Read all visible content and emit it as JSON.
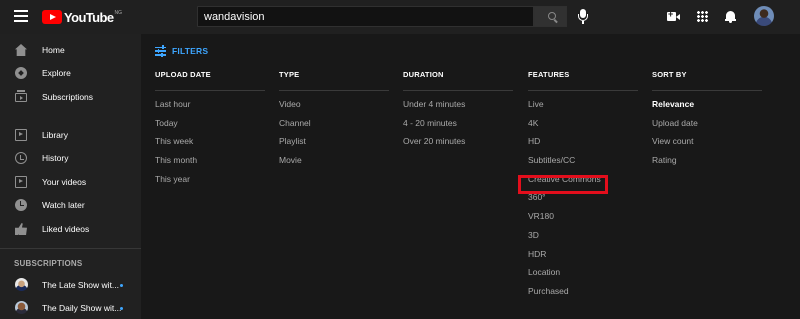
{
  "masthead": {
    "logo_text": "YouTube",
    "logo_country": "NG",
    "search_value": "wandavision"
  },
  "sidebar": {
    "items": [
      {
        "label": "Home",
        "icon": "home-icon"
      },
      {
        "label": "Explore",
        "icon": "explore-icon"
      },
      {
        "label": "Subscriptions",
        "icon": "subscriptions-icon"
      },
      {
        "label": "Library",
        "icon": "library-icon"
      },
      {
        "label": "History",
        "icon": "history-icon"
      },
      {
        "label": "Your videos",
        "icon": "your-videos-icon"
      },
      {
        "label": "Watch later",
        "icon": "watch-later-icon"
      },
      {
        "label": "Liked videos",
        "icon": "liked-videos-icon"
      }
    ],
    "subscriptions_header": "SUBSCRIPTIONS",
    "subscriptions": [
      {
        "label": "The Late Show wit..."
      },
      {
        "label": "The Daily Show wit..."
      }
    ]
  },
  "filters": {
    "toggle_label": "FILTERS",
    "accent_color": "#3ea6ff",
    "highlight_color": "#e30e1c",
    "columns": [
      {
        "header": "UPLOAD DATE",
        "items": [
          "Last hour",
          "Today",
          "This week",
          "This month",
          "This year"
        ]
      },
      {
        "header": "TYPE",
        "items": [
          "Video",
          "Channel",
          "Playlist",
          "Movie"
        ]
      },
      {
        "header": "DURATION",
        "items": [
          "Under 4 minutes",
          "4 - 20 minutes",
          "Over 20 minutes"
        ]
      },
      {
        "header": "FEATURES",
        "items": [
          "Live",
          "4K",
          "HD",
          "Subtitles/CC",
          "Creative Commons",
          "360°",
          "VR180",
          "3D",
          "HDR",
          "Location",
          "Purchased"
        ]
      },
      {
        "header": "SORT BY",
        "items": [
          "Relevance",
          "Upload date",
          "View count",
          "Rating"
        ],
        "selected": "Relevance"
      }
    ]
  }
}
